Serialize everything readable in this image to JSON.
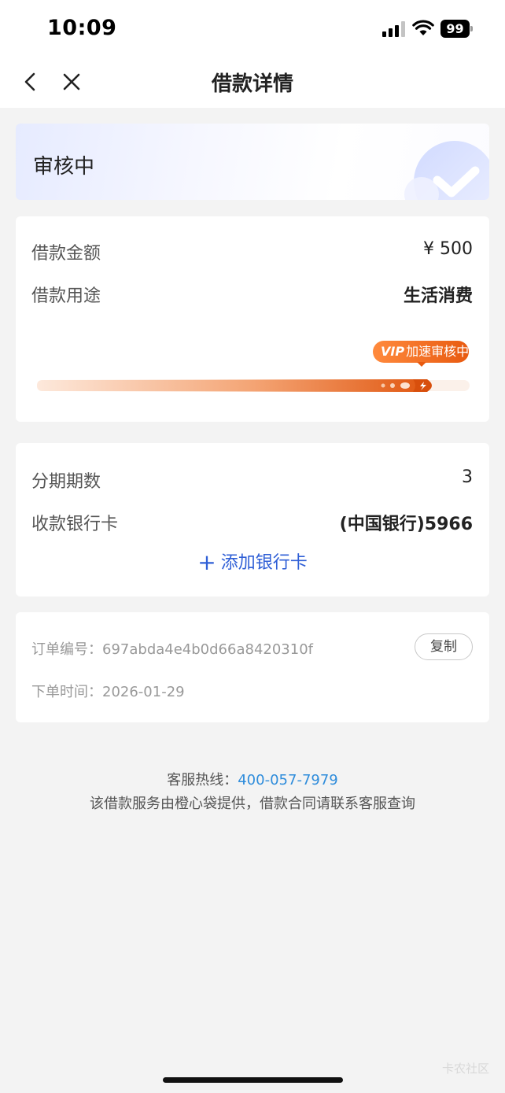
{
  "status_bar": {
    "time": "10:09",
    "battery": "99"
  },
  "nav": {
    "title": "借款详情"
  },
  "status_card": {
    "status": "审核中"
  },
  "loan": {
    "amount_label": "借款金额",
    "amount_value": "¥ 500",
    "purpose_label": "借款用途",
    "purpose_value": "生活消费",
    "vip_mark": "VIP",
    "vip_text": "加速审核中"
  },
  "bank": {
    "installments_label": "分期期数",
    "installments_value": "3",
    "card_label": "收款银行卡",
    "card_value": "(中国银行)5966",
    "add_plus": "+",
    "add_text": "添加银行卡"
  },
  "order": {
    "number_label": "订单编号：",
    "number_value": "697abda4e4b0d66a8420310f",
    "copy_label": "复制",
    "time_label": "下单时间：",
    "time_value": "2026-01-29"
  },
  "footer": {
    "hotline_label": "客服热线：",
    "hotline_number": "400-057-7979",
    "note": "该借款服务由橙心袋提供，借款合同请联系客服查询"
  },
  "watermark": "卡农社区",
  "colors": {
    "accent_blue": "#2f5fd6",
    "hotline_blue": "#2e8cdb",
    "progress_orange": "#e85a10",
    "page_bg": "#f3f3f3"
  }
}
